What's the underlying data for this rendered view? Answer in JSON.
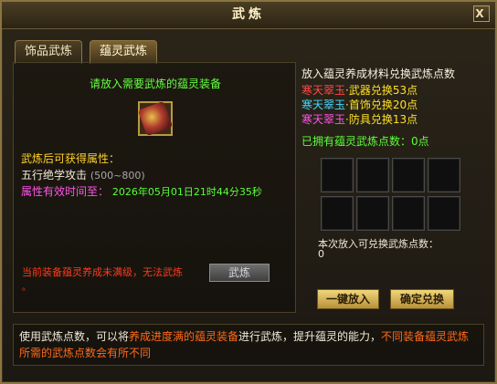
{
  "window": {
    "title": "武炼",
    "close_glyph": "X"
  },
  "tabs": [
    {
      "label": "饰品武炼",
      "active": false
    },
    {
      "label": "蕴灵武炼",
      "active": true
    }
  ],
  "left": {
    "hint": "请放入需要武炼的蕴灵装备",
    "attr_title": "武炼后可获得属性：",
    "attr_line": "五行绝学攻击",
    "attr_range": "(500~800)",
    "time_label": "属性有效时间至：",
    "time_value": "2026年05月01日21时44分35秒",
    "warning": "当前装备蕴灵养成未满级，无法武炼",
    "warning_dot": "。",
    "button_label": "武炼"
  },
  "right": {
    "title": "放入蕴灵养成材料兑换武炼点数",
    "materials": [
      {
        "name": "寒天翠玉",
        "rest": "·武器兑换53点"
      },
      {
        "name": "寒天翠玉",
        "rest": "·首饰兑换20点"
      },
      {
        "name": "寒天翠玉",
        "rest": "·防具兑换13点"
      }
    ],
    "owned": "已拥有蕴灵武炼点数：0点",
    "exchange_label": "本次放入可兑换武炼点数：",
    "exchange_value": "0",
    "btn_one_key": "一键放入",
    "btn_confirm": "确定兑换"
  },
  "footer": {
    "part1": "使用武炼点数，可以将",
    "part2": "养成进度满的蕴灵装备",
    "part3": "进行武炼，提升蕴灵的能力，",
    "part4": "不同装备蕴灵武炼所需的武炼点数会有所不同"
  },
  "colors": {
    "green": "#58ff3a",
    "yellow": "#ffd02a",
    "pink": "#ff54e8",
    "red": "#ff3a1a",
    "orange": "#ff6a1a"
  }
}
